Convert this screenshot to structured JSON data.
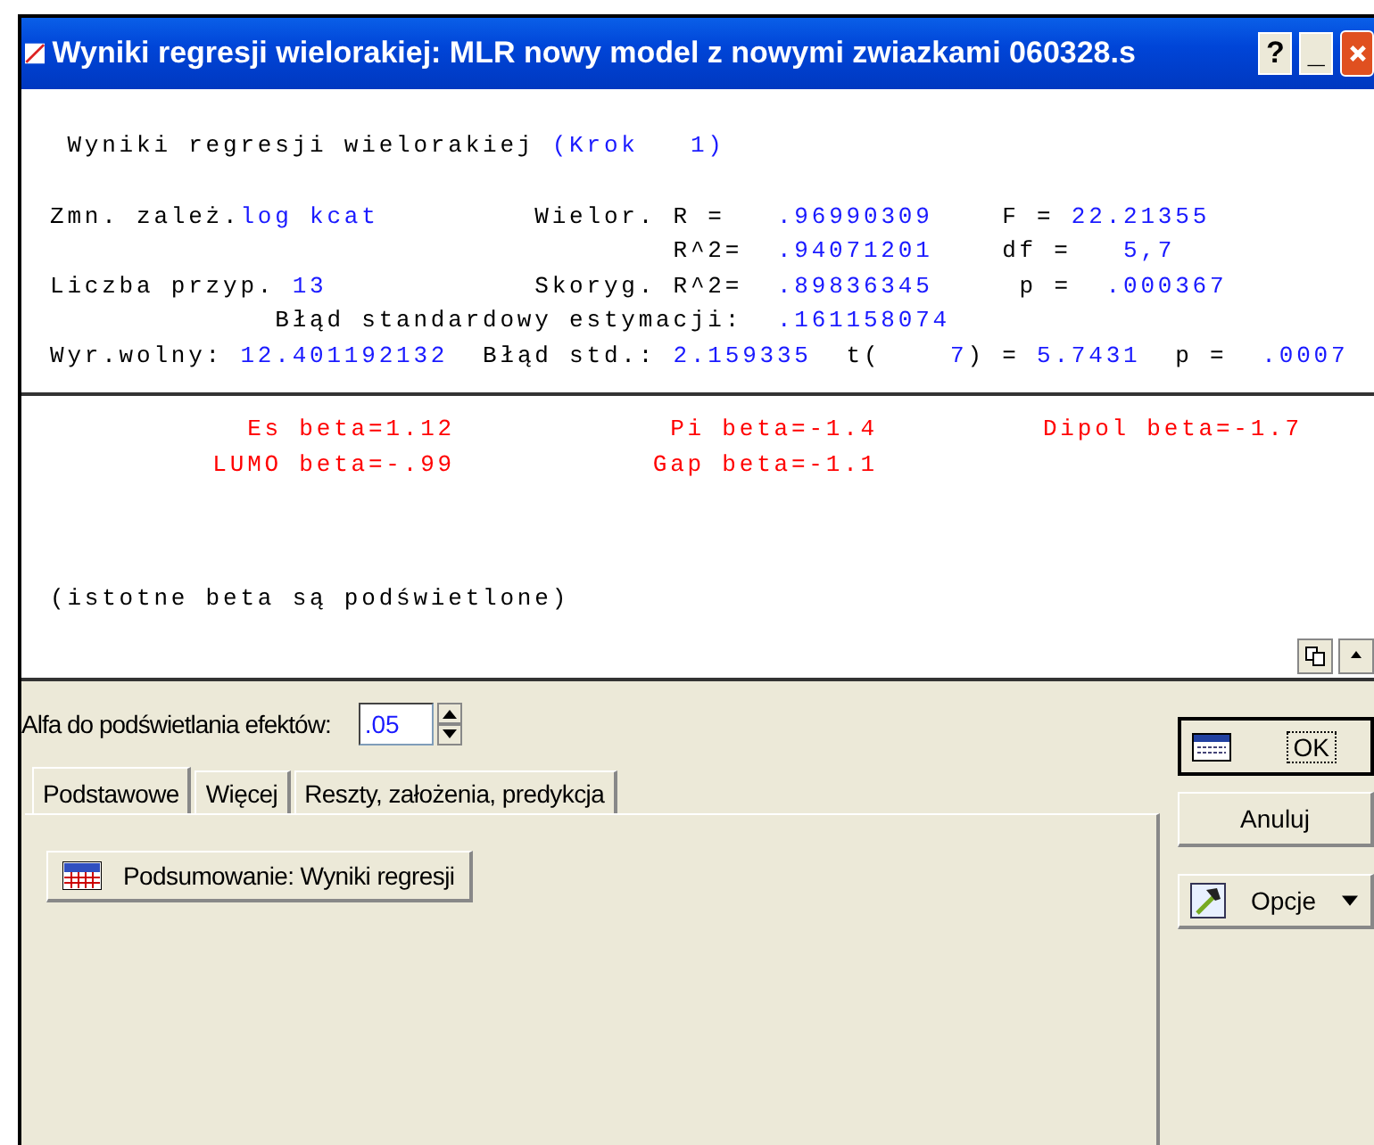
{
  "window": {
    "title": "Wyniki regresji wielorakiej: MLR nowy model z nowymi zwiazkami 060328.s",
    "controls": [
      "?",
      "_"
    ]
  },
  "report": {
    "header": [
      {
        "text": " Wyniki regresji wielorakiej ",
        "kind": "label"
      },
      {
        "text": "(Krok   1)",
        "kind": "value"
      }
    ],
    "lines": [
      [
        {
          "text": "Zmn. zależ.",
          "kind": "label"
        },
        {
          "text": "log kcat",
          "kind": "value"
        },
        {
          "text": "         Wielor. R =   ",
          "kind": "label"
        },
        {
          "text": ".96990309",
          "kind": "value"
        },
        {
          "text": "    F = ",
          "kind": "label"
        },
        {
          "text": "22.21355",
          "kind": "value"
        }
      ],
      [
        {
          "text": "                                    R^2=  ",
          "kind": "label"
        },
        {
          "text": ".94071201",
          "kind": "value"
        },
        {
          "text": "    df =   ",
          "kind": "label"
        },
        {
          "text": "5,7",
          "kind": "value"
        }
      ],
      [
        {
          "text": "Liczba przyp. ",
          "kind": "label"
        },
        {
          "text": "13",
          "kind": "value"
        },
        {
          "text": "            Skoryg. R^2=  ",
          "kind": "label"
        },
        {
          "text": ".89836345",
          "kind": "value"
        },
        {
          "text": "     p =  ",
          "kind": "label"
        },
        {
          "text": ".000367",
          "kind": "value"
        }
      ],
      [
        {
          "text": "             Błąd standardowy estymacji:  ",
          "kind": "label"
        },
        {
          "text": ".161158074",
          "kind": "value"
        }
      ],
      [
        {
          "text": "Wyr.wolny: ",
          "kind": "label"
        },
        {
          "text": "12.401192132",
          "kind": "value"
        },
        {
          "text": "  Błąd std.: ",
          "kind": "label"
        },
        {
          "text": "2.159335",
          "kind": "value"
        },
        {
          "text": "  t(    ",
          "kind": "label"
        },
        {
          "text": "7",
          "kind": "value"
        },
        {
          "text": ") = ",
          "kind": "label"
        },
        {
          "text": "5.7431",
          "kind": "value"
        },
        {
          "text": "  p =  ",
          "kind": "label"
        },
        {
          "text": ".0007",
          "kind": "value"
        }
      ]
    ],
    "betas": [
      "Es beta=1.12",
      "Pi beta=-1.4",
      "Dipol beta=-1.7",
      "LUMO beta=-.99",
      "Gap beta=-1.1"
    ],
    "note": "(istotne beta są podświetlone)"
  },
  "alpha": {
    "label": "Alfa do podświetlania efektów:",
    "value": ".05"
  },
  "tabs": [
    {
      "label": "Podstawowe",
      "selected": true
    },
    {
      "label": "Więcej",
      "selected": false
    },
    {
      "label": "Reszty, założenia, predykcja",
      "selected": false
    }
  ],
  "summary_button": "Podsumowanie:  Wyniki regresji",
  "side_buttons": [
    {
      "label": "OK",
      "kind": "ok",
      "default": true
    },
    {
      "label": "Anuluj",
      "kind": "plain",
      "default": false
    },
    {
      "label": "Opcje",
      "kind": "menu",
      "default": false
    }
  ]
}
